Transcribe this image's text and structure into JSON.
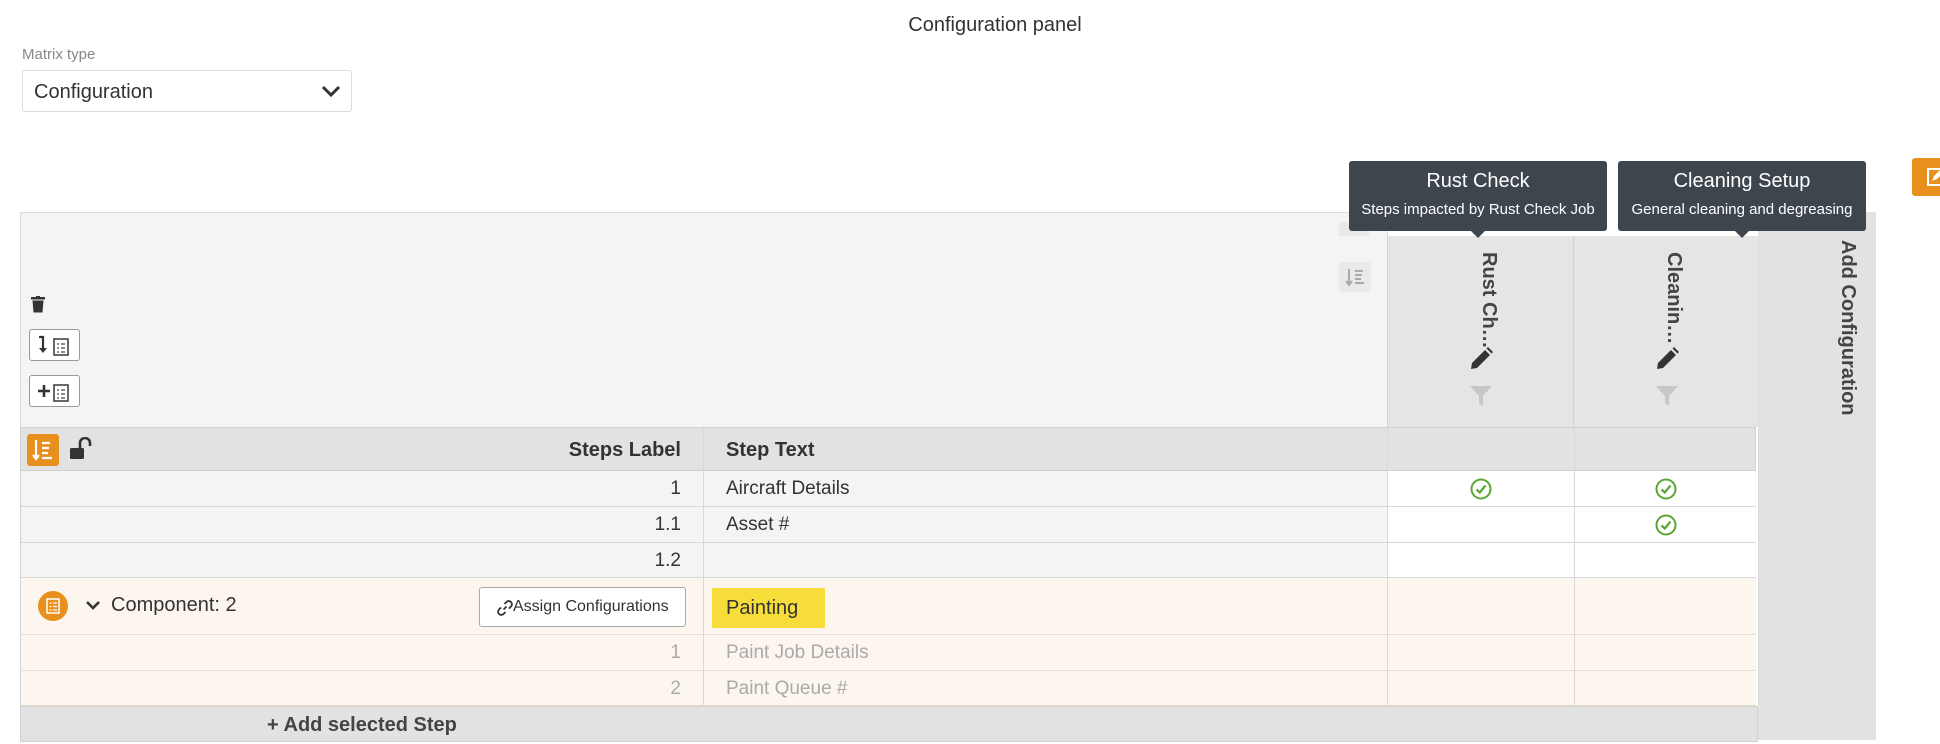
{
  "title": "Configuration panel",
  "matrix_type": {
    "label": "Matrix type",
    "value": "Configuration"
  },
  "tooltips": [
    {
      "title": "Rust Check",
      "subtitle": "Steps impacted by Rust Check Job"
    },
    {
      "title": "Cleaning Setup",
      "subtitle": "General cleaning and degreasing"
    }
  ],
  "columns": [
    {
      "label": "Rust Ch…"
    },
    {
      "label": "Cleanin…"
    }
  ],
  "add_configuration_label": "Add Configuration",
  "table": {
    "steps_label_header": "Steps Label",
    "step_text_header": "Step Text",
    "rows": [
      {
        "label": "1",
        "text": "Aircraft Details",
        "checks": [
          true,
          true
        ]
      },
      {
        "label": "1.1",
        "text": "Asset #",
        "checks": [
          false,
          true
        ]
      },
      {
        "label": "1.2",
        "text": "",
        "checks": [
          false,
          false
        ]
      }
    ],
    "component": {
      "name": "Component: 2",
      "assign_label": "Assign Configurations",
      "step_text": "Painting",
      "rows": [
        {
          "label": "1",
          "text": "Paint Job Details"
        },
        {
          "label": "2",
          "text": "Paint Queue #"
        }
      ]
    },
    "add_step_label": "+ Add selected Step"
  },
  "colors": {
    "accent": "#e8901d",
    "check": "#5aa632",
    "tooltip": "#3d454d",
    "highlight": "#f7dd3a"
  }
}
